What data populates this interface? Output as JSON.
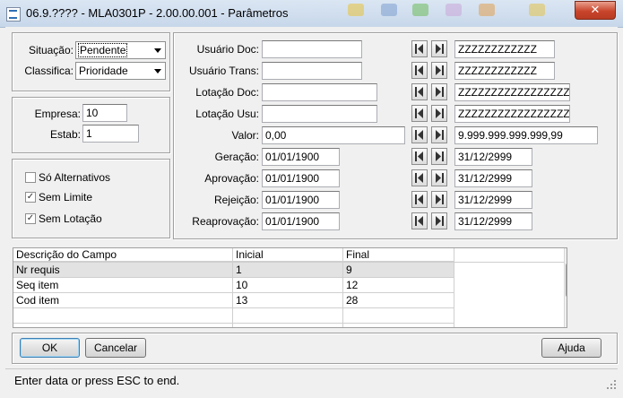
{
  "window": {
    "title": "06.9.???? - MLA0301P - 2.00.00.001 - Parâmetros",
    "close_glyph": "✕"
  },
  "filters": {
    "situacao": {
      "label": "Situação:",
      "value": "Pendente"
    },
    "classifica": {
      "label": "Classifica:",
      "value": "Prioridade"
    }
  },
  "company": {
    "empresa": {
      "label": "Empresa:",
      "value": "10"
    },
    "estab": {
      "label": "Estab:",
      "value": "1"
    }
  },
  "options": {
    "so_alternativos": {
      "label": "Só Alternativos",
      "checked": false
    },
    "sem_limite": {
      "label": "Sem Limite",
      "checked": true
    },
    "sem_lotacao": {
      "label": "Sem Lotação",
      "checked": true
    },
    "check_glyph": "✓"
  },
  "ranges": [
    {
      "label": "Usuário Doc:",
      "from": "",
      "to": "ZZZZZZZZZZZZ"
    },
    {
      "label": "Usuário Trans:",
      "from": "",
      "to": "ZZZZZZZZZZZZ"
    },
    {
      "label": "Lotação Doc:",
      "from": "",
      "to": "ZZZZZZZZZZZZZZZZZZZZ"
    },
    {
      "label": "Lotação Usu:",
      "from": "",
      "to": "ZZZZZZZZZZZZZZZZZZZZ"
    },
    {
      "label": "Valor:",
      "from": "0,00",
      "to": "9.999.999.999.999,99"
    },
    {
      "label": "Geração:",
      "from": "01/01/1900",
      "to": "31/12/2999"
    },
    {
      "label": "Aprovação:",
      "from": "01/01/1900",
      "to": "31/12/2999"
    },
    {
      "label": "Rejeição:",
      "from": "01/01/1900",
      "to": "31/12/2999"
    },
    {
      "label": "Reaprovação:",
      "from": "01/01/1900",
      "to": "31/12/2999"
    }
  ],
  "grid": {
    "columns": [
      "Descrição do Campo",
      "Inicial",
      "Final"
    ],
    "rows": [
      [
        "Nr requis",
        "1",
        "9"
      ],
      [
        "Seq item",
        "10",
        "12"
      ],
      [
        "Cod item",
        "13",
        "28"
      ]
    ],
    "selected_row": 0
  },
  "buttons": {
    "ok": "OK",
    "cancelar": "Cancelar",
    "ajuda": "Ajuda"
  },
  "status": {
    "text": "Enter data or press ESC to end."
  }
}
